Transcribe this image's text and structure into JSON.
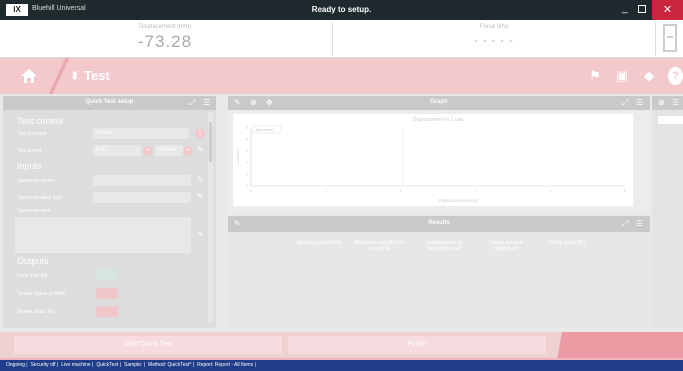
{
  "titlebar": {
    "app_name": "Bluehill Universal",
    "status": "Ready to setup.",
    "minimize": "_",
    "close": "✕"
  },
  "readouts": {
    "left_label": "Displacement (mm)",
    "left_value": "-73.28",
    "right_label": "Force (kN)",
    "right_value": "- - - - -"
  },
  "header": {
    "title": "Test"
  },
  "left_panel": {
    "title": "Quick Test setup",
    "test_control": "Test control",
    "test_direction_label": "Test direction",
    "test_direction_value": "Tensile",
    "test_speed_label": "Test speed",
    "test_speed_value": "5.00",
    "test_speed_unit": "mm/min",
    "inputs": "Inputs",
    "specimen_name_label": "Specimen name",
    "specimen_label_label": "Specimen label type",
    "specimen_note_label": "Specimen note",
    "outputs": "Outputs",
    "output1_label": "Peak load (N)",
    "output2_label": "Tensile stress at MAX",
    "output3_label": "Tensile strain (%)"
  },
  "graph": {
    "title": "Graph",
    "plot_title": "Displacement vs. Load",
    "x_label": "Displacement (mm)",
    "y_label": "Load (N)",
    "legend": "Specimen 1"
  },
  "chart_data": {
    "type": "line",
    "title": "Displacement vs. Load",
    "xlabel": "Displacement (mm)",
    "ylabel": "Load (N)",
    "x_ticks": [
      "0",
      "1",
      "2",
      "3",
      "4",
      "5"
    ],
    "y_ticks": [
      "0",
      "1",
      "2",
      "3",
      "4",
      "5"
    ],
    "series": []
  },
  "results": {
    "title": "Results",
    "columns": [
      "Specimen label Unit",
      "Maximum load (Force): Load (N)",
      "Displacement at Maximum Load",
      "Tensile at break (Standard)",
      "Tensile strain (%)"
    ]
  },
  "bottom": {
    "left_button": "Start Quick Test",
    "mid_button": "Finish"
  },
  "statusbar": {
    "items": [
      "Ongoing",
      "Security off",
      "Live machine",
      "QuickTest",
      "Sample:",
      "Method: QuickTest*",
      "Report: Report - All Items"
    ]
  }
}
